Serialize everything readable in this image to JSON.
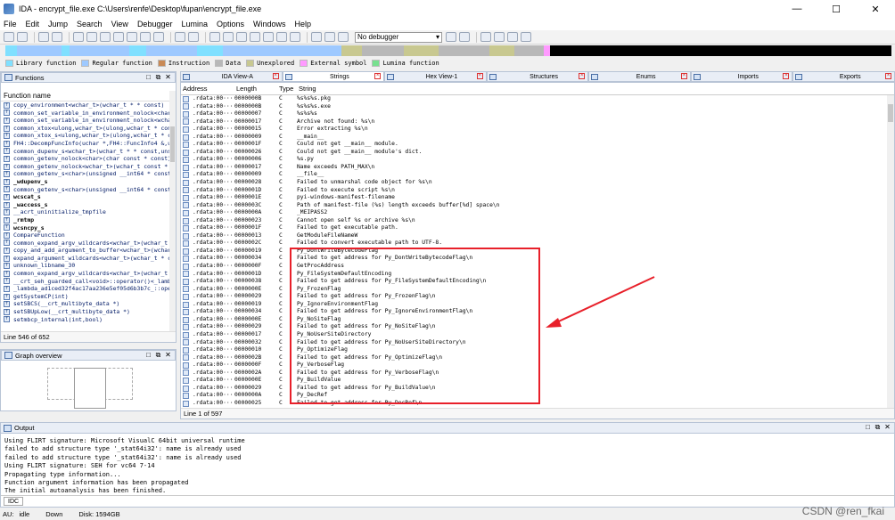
{
  "window": {
    "title": "IDA - encrypt_file.exe C:\\Users\\renfe\\Desktop\\fupan\\encrypt_file.exe",
    "minimize": "—",
    "maximize": "☐",
    "close": "✕"
  },
  "menu": [
    "File",
    "Edit",
    "Jump",
    "Search",
    "View",
    "Debugger",
    "Lumina",
    "Options",
    "Windows",
    "Help"
  ],
  "toolbar": {
    "debugger_select": "No debugger"
  },
  "legend": [
    {
      "label": "Library function",
      "color": "#80e0ff"
    },
    {
      "label": "Regular function",
      "color": "#9ec9ff"
    },
    {
      "label": "Instruction",
      "color": "#c98a56"
    },
    {
      "label": "Data",
      "color": "#b8b8b8"
    },
    {
      "label": "Unexplored",
      "color": "#c8c890"
    },
    {
      "label": "External symbol",
      "color": "#ff9aff"
    },
    {
      "label": "Lumina function",
      "color": "#78e08f"
    }
  ],
  "functions_panel": {
    "title": "Functions",
    "column": "Function name",
    "status": "Line 546 of 652",
    "items": [
      {
        "name": "copy_environment<wchar_t>(wchar_t * * const)",
        "bold": false
      },
      {
        "name": "common_set_variable_in_environment_nolock<char>",
        "bold": false
      },
      {
        "name": "common_set_variable_in_environment_nolock<wchar>",
        "bold": false
      },
      {
        "name": "common_xtox<ulong,wchar_t>(ulong,wchar_t * const",
        "bold": false
      },
      {
        "name": "common_xtox_s<ulong,wchar_t>(ulong,wchar_t * cor",
        "bold": false
      },
      {
        "name": "FH4::DecompFuncInfo(uchar *,FH4::FuncInfo4 &,ui",
        "bold": false
      },
      {
        "name": "common_dupenv_s<wchar_t>(wchar_t * * const,unsi",
        "bold": false
      },
      {
        "name": "common_getenv_nolock<char>(char const * const)",
        "bold": false
      },
      {
        "name": "common_getenv_nolock<wchar_t>(wchar_t const * co",
        "bold": false
      },
      {
        "name": "common_getenv_s<char>(unsigned __int64 * const",
        "bold": false
      },
      {
        "name": "_wdupenv_s",
        "bold": true
      },
      {
        "name": "common_getenv_s<char>(unsigned __int64 * const",
        "bold": false
      },
      {
        "name": "wcscat_s",
        "bold": true
      },
      {
        "name": "_waccess_s",
        "bold": true
      },
      {
        "name": "__acrt_uninitialize_tmpfile",
        "bold": false
      },
      {
        "name": "_rmtmp",
        "bold": true
      },
      {
        "name": "wcsncpy_s",
        "bold": true
      },
      {
        "name": "CompareFunction",
        "bold": false
      },
      {
        "name": "common_expand_argv_wildcards<wchar_t>(wchar_t *",
        "bold": false
      },
      {
        "name": "copy_and_add_argument_to_buffer<wchar_t>(wchar_t",
        "bold": false
      },
      {
        "name": "expand_argument_wildcards<wchar_t>(wchar_t * cd",
        "bold": false
      },
      {
        "name": "unknown_libname_30",
        "bold": false
      },
      {
        "name": "common_expand_argv_wildcards<wchar_t>(wchar_t *",
        "bold": false
      },
      {
        "name": "__crt_seh_guarded_call<void>::operator()<_lamb",
        "bold": false
      },
      {
        "name": "_lambda_ad1ced32f4ac17aa236e5ef05d6b3b7c_::oper",
        "bold": false
      },
      {
        "name": "getSystemCP(int)",
        "bold": false
      },
      {
        "name": "setSBCS(__crt_multibyte_data *)",
        "bold": false
      },
      {
        "name": "setSBUpLow(__crt_multibyte_data *)",
        "bold": false
      },
      {
        "name": "setmbcp_internal(int,bool)",
        "bold": false
      }
    ]
  },
  "graph_overview": {
    "title": "Graph overview"
  },
  "tabs": [
    {
      "label": "IDA View-A",
      "active": false
    },
    {
      "label": "Strings",
      "active": true
    },
    {
      "label": "Hex View-1",
      "active": false
    },
    {
      "label": "Structures",
      "active": false
    },
    {
      "label": "Enums",
      "active": false
    },
    {
      "label": "Imports",
      "active": false
    },
    {
      "label": "Exports",
      "active": false
    }
  ],
  "strings_view": {
    "columns": {
      "address": "Address",
      "length": "Length",
      "type": "Type",
      "string": "String"
    },
    "status": "Line 1 of 597",
    "rows": [
      {
        "address": ".rdata:00···",
        "length": "0000000B",
        "type": "C",
        "string": "%s%s%s.pkg"
      },
      {
        "address": ".rdata:00···",
        "length": "0000000B",
        "type": "C",
        "string": "%s%s%s.exe"
      },
      {
        "address": ".rdata:00···",
        "length": "00000007",
        "type": "C",
        "string": "%s%s%s"
      },
      {
        "address": ".rdata:00···",
        "length": "00000017",
        "type": "C",
        "string": "Archive not found: %s\\n"
      },
      {
        "address": ".rdata:00···",
        "length": "00000015",
        "type": "C",
        "string": "Error extracting %s\\n"
      },
      {
        "address": ".rdata:00···",
        "length": "00000009",
        "type": "C",
        "string": "__main__"
      },
      {
        "address": ".rdata:00···",
        "length": "0000001F",
        "type": "C",
        "string": "Could not get __main__ module."
      },
      {
        "address": ".rdata:00···",
        "length": "00000026",
        "type": "C",
        "string": "Could not get __main__ module's dict."
      },
      {
        "address": ".rdata:00···",
        "length": "00000006",
        "type": "C",
        "string": "%s.py"
      },
      {
        "address": ".rdata:00···",
        "length": "00000017",
        "type": "C",
        "string": "Name exceeds PATH_MAX\\n"
      },
      {
        "address": ".rdata:00···",
        "length": "00000009",
        "type": "C",
        "string": "__file__"
      },
      {
        "address": ".rdata:00···",
        "length": "00000028",
        "type": "C",
        "string": "Failed to unmarshal code object for %s\\n"
      },
      {
        "address": ".rdata:00···",
        "length": "0000001D",
        "type": "C",
        "string": "Failed to execute script %s\\n"
      },
      {
        "address": ".rdata:00···",
        "length": "0000001E",
        "type": "C",
        "string": "pyi-windows-manifest-filename"
      },
      {
        "address": ".rdata:00···",
        "length": "0000003C",
        "type": "C",
        "string": "Path of manifest-file (%s) length exceeds buffer[%d] space\\n"
      },
      {
        "address": ".rdata:00···",
        "length": "0000000A",
        "type": "C",
        "string": "_MEIPASS2"
      },
      {
        "address": ".rdata:00···",
        "length": "00000023",
        "type": "C",
        "string": "Cannot open self %s or archive %s\\n"
      },
      {
        "address": ".rdata:00···",
        "length": "0000001F",
        "type": "C",
        "string": "Failed to get executable path."
      },
      {
        "address": ".rdata:00···",
        "length": "00000013",
        "type": "C",
        "string": "GetModuleFileNameW"
      },
      {
        "address": ".rdata:00···",
        "length": "0000002C",
        "type": "C",
        "string": "Failed to convert executable path to UTF-8."
      },
      {
        "address": ".rdata:00···",
        "length": "00000019",
        "type": "C",
        "string": "Py_DontWriteBytecodeFlag"
      },
      {
        "address": ".rdata:00···",
        "length": "00000034",
        "type": "C",
        "string": "Failed to get address for Py_DontWriteBytecodeFlag\\n"
      },
      {
        "address": ".rdata:00···",
        "length": "0000000F",
        "type": "C",
        "string": "GetProcAddress"
      },
      {
        "address": ".rdata:00···",
        "length": "0000001D",
        "type": "C",
        "string": "Py_FileSystemDefaultEncoding"
      },
      {
        "address": ".rdata:00···",
        "length": "00000038",
        "type": "C",
        "string": "Failed to get address for Py_FileSystemDefaultEncoding\\n"
      },
      {
        "address": ".rdata:00···",
        "length": "0000000E",
        "type": "C",
        "string": "Py_FrozenFlag"
      },
      {
        "address": ".rdata:00···",
        "length": "00000029",
        "type": "C",
        "string": "Failed to get address for Py_FrozenFlag\\n"
      },
      {
        "address": ".rdata:00···",
        "length": "00000019",
        "type": "C",
        "string": "Py_IgnoreEnvironmentFlag"
      },
      {
        "address": ".rdata:00···",
        "length": "00000034",
        "type": "C",
        "string": "Failed to get address for Py_IgnoreEnvironmentFlag\\n"
      },
      {
        "address": ".rdata:00···",
        "length": "0000000E",
        "type": "C",
        "string": "Py_NoSiteFlag"
      },
      {
        "address": ".rdata:00···",
        "length": "00000029",
        "type": "C",
        "string": "Failed to get address for Py_NoSiteFlag\\n"
      },
      {
        "address": ".rdata:00···",
        "length": "00000017",
        "type": "C",
        "string": "Py_NoUserSiteDirectory"
      },
      {
        "address": ".rdata:00···",
        "length": "00000032",
        "type": "C",
        "string": "Failed to get address for Py_NoUserSiteDirectory\\n"
      },
      {
        "address": ".rdata:00···",
        "length": "00000010",
        "type": "C",
        "string": "Py_OptimizeFlag"
      },
      {
        "address": ".rdata:00···",
        "length": "0000002B",
        "type": "C",
        "string": "Failed to get address for Py_OptimizeFlag\\n"
      },
      {
        "address": ".rdata:00···",
        "length": "0000000F",
        "type": "C",
        "string": "Py_VerboseFlag"
      },
      {
        "address": ".rdata:00···",
        "length": "0000002A",
        "type": "C",
        "string": "Failed to get address for Py_VerboseFlag\\n"
      },
      {
        "address": ".rdata:00···",
        "length": "0000000E",
        "type": "C",
        "string": "Py_BuildValue"
      },
      {
        "address": ".rdata:00···",
        "length": "00000029",
        "type": "C",
        "string": "Failed to get address for Py_BuildValue\\n"
      },
      {
        "address": ".rdata:00···",
        "length": "0000000A",
        "type": "C",
        "string": "Py_DecRef"
      },
      {
        "address": ".rdata:00···",
        "length": "00000025",
        "type": "C",
        "string": "Failed to get address for Py_DecRef\\n"
      }
    ]
  },
  "output": {
    "title": "Output",
    "lines": [
      "Using FLIRT signature: Microsoft VisualC 64bit universal runtime",
      "failed to add structure type '_stat64i32': name is already used",
      "failed to add structure type '_stat64i32': name is already used",
      "Using FLIRT signature: SEH for vc64 7-14",
      "Propagating type information...",
      "Function argument information has been propagated",
      "The initial autoanalysis has been finished."
    ],
    "idc_label": "IDC"
  },
  "statusbar": {
    "au": "AU:",
    "state": "idle",
    "direction": "Down",
    "disk": "Disk: 1594GB"
  },
  "watermark": "CSDN @ren_fkai",
  "colors": {
    "highlight_box": "#e8202a",
    "arrow": "#e8202a"
  }
}
